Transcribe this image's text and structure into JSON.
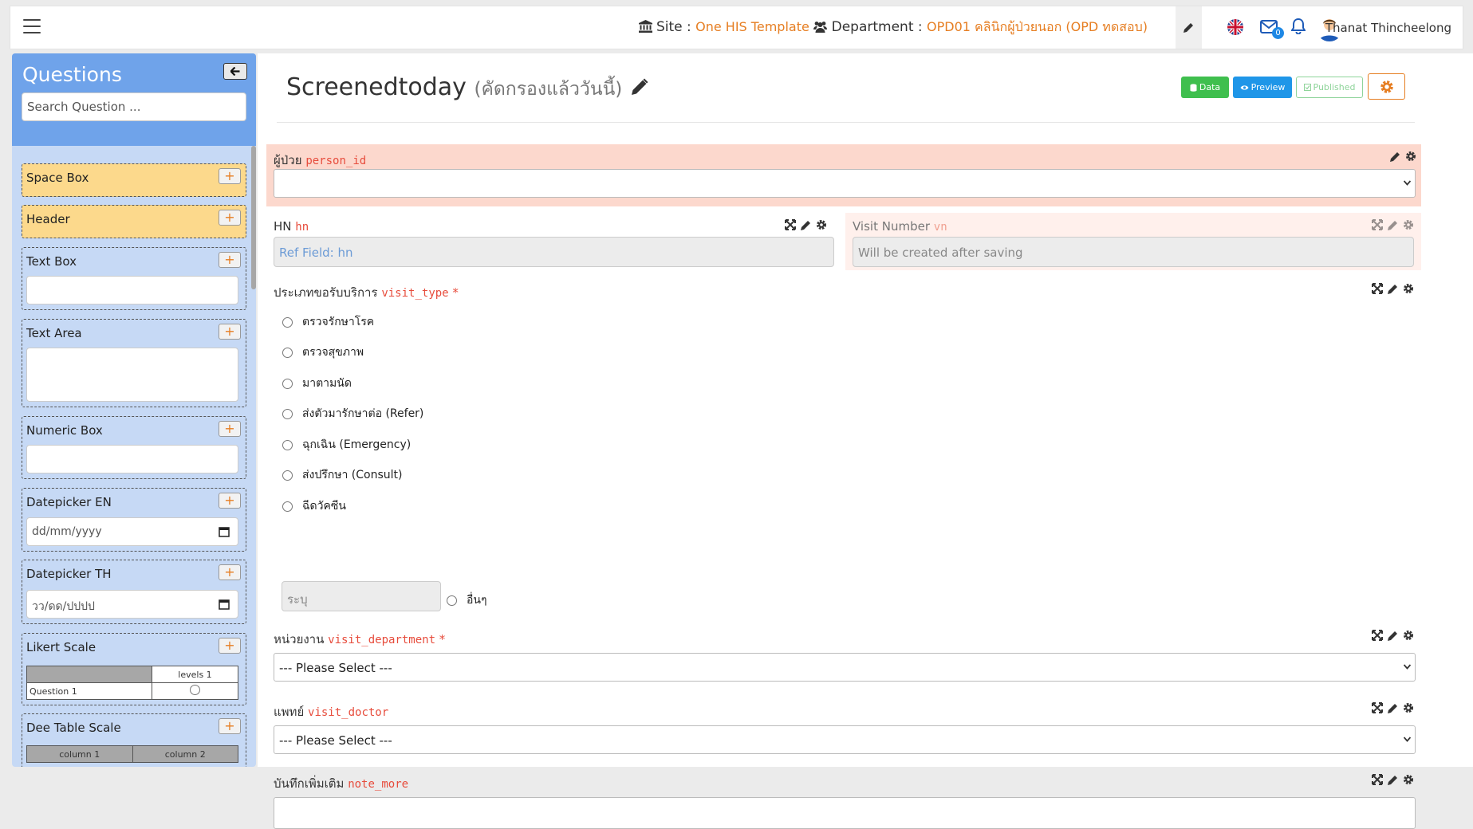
{
  "navbar": {
    "site_label": "Site :",
    "site_value": "One HIS Template",
    "department_label": "Department :",
    "department_value": "OPD01 คลินิกผู้ป่วยนอก (OPD ทดสอบ)",
    "mail_count": "0",
    "username": "Thanat Thincheelong"
  },
  "sidebar": {
    "title": "Questions",
    "search_placeholder": "Search Question ...",
    "items": [
      {
        "label": "Space Box"
      },
      {
        "label": "Header"
      },
      {
        "label": "Text Box"
      },
      {
        "label": "Text Area"
      },
      {
        "label": "Numeric Box"
      },
      {
        "label": "Datepicker EN",
        "placeholder": "dd/mm/yyyy"
      },
      {
        "label": "Datepicker TH",
        "placeholder": "วว/ดด/ปปปป"
      },
      {
        "label": "Likert Scale",
        "col": "levels 1",
        "row": "Question 1"
      },
      {
        "label": "Dee Table Scale",
        "col1": "column 1",
        "col2": "column 2"
      }
    ],
    "add_label": "+"
  },
  "form": {
    "title": "Screenedtoday",
    "subtitle": "(คัดกรองแล้ววันนี้)",
    "buttons": {
      "data": "Data",
      "preview": "Preview",
      "published": "Published"
    },
    "fields": {
      "person": {
        "label": "ผู้ป่วย",
        "code": "person_id"
      },
      "hn": {
        "label": "HN",
        "code": "hn",
        "placeholder": "Ref Field: hn"
      },
      "vn": {
        "label": "Visit Number",
        "code": "vn",
        "placeholder": "Will be created after saving"
      },
      "visit_type": {
        "label": "ประเภทขอรับบริการ",
        "code": "visit_type",
        "required": "*",
        "options": [
          "ตรวจรักษาโรค",
          "ตรวจสุขภาพ",
          "มาตามนัด",
          "ส่งตัวมารักษาต่อ (Refer)",
          "ฉุกเฉิน (Emergency)",
          "ส่งปรึกษา (Consult)",
          "ฉีดวัคซีน"
        ],
        "other_placeholder": "ระบุ",
        "other_label": "อื่นๆ"
      },
      "visit_department": {
        "label": "หน่วยงาน",
        "code": "visit_department",
        "required": "*",
        "value": "--- Please Select ---"
      },
      "visit_doctor": {
        "label": "แพทย์",
        "code": "visit_doctor",
        "value": "--- Please Select ---"
      },
      "note_more": {
        "label": "บันทึกเพิ่มเติม",
        "code": "note_more"
      }
    }
  },
  "colors": {
    "accent_orange": "#e67e22",
    "sidebar_header": "#6fa3ea",
    "sidebar_bg": "#c6d9f5",
    "item_yellow": "#fcd98c",
    "field_pink": "#fcd8cd",
    "required_red": "#e74c3c",
    "btn_green": "#3fbf4e",
    "btn_blue": "#1f96e8"
  }
}
